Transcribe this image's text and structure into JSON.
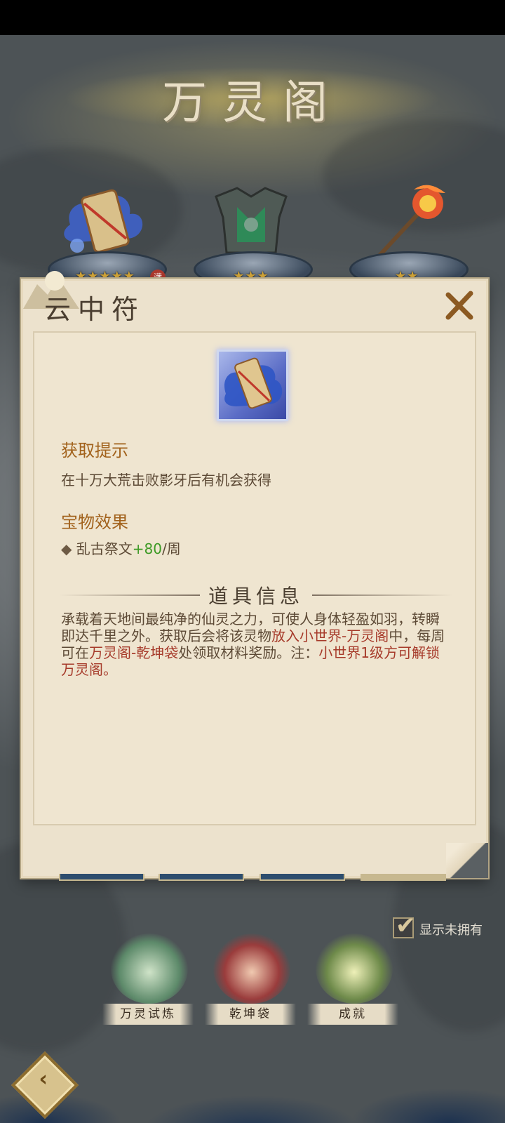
{
  "header": {
    "title": "万灵阁"
  },
  "treasures": [
    {
      "name": "scroll",
      "stars": "★★★★★",
      "badge": "满"
    },
    {
      "name": "armor",
      "stars": "★★★"
    },
    {
      "name": "staff",
      "stars": "★★"
    }
  ],
  "modal": {
    "title": "云中符",
    "acquire_heading": "获取提示",
    "acquire_text": "在十万大荒击败影牙后有机会获得",
    "effect_heading": "宝物效果",
    "effect_bullet": "◆",
    "effect_name": " 乱古祭文",
    "effect_value": "+80",
    "effect_unit": "/周",
    "info_heading": "道具信息",
    "info_part1": "承载着天地间最纯净的仙灵之力，可使人身体轻盈如羽，转瞬即达千里之外。获取后会将该灵物",
    "info_red1": "放入小世界-万灵阁",
    "info_part2": "中，每周可在",
    "info_red2": "万灵阁-乾坤袋",
    "info_part3": "处领取材料奖励。注：",
    "info_red3": "小世界1级方可解锁万灵阁。"
  },
  "show_unowned": {
    "label": "显示未拥有",
    "checked": true
  },
  "features": [
    {
      "label": "万灵试炼"
    },
    {
      "label": "乾坤袋"
    },
    {
      "label": "成就"
    }
  ],
  "colors": {
    "accent_text": "#a2621c",
    "highlight_red": "#a63a2a",
    "green_value": "#3d9a25",
    "parchment": "#ece2cd"
  }
}
